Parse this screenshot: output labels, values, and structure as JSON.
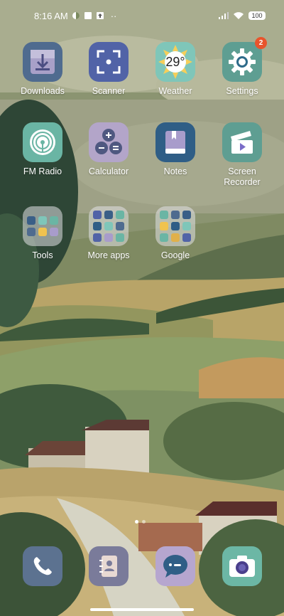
{
  "status": {
    "time": "8:16 AM",
    "battery": "100",
    "more": "··"
  },
  "apps": [
    {
      "id": "downloads",
      "label": "Downloads",
      "icon": "download-icon"
    },
    {
      "id": "scanner",
      "label": "Scanner",
      "icon": "scanner-icon"
    },
    {
      "id": "weather",
      "label": "Weather",
      "icon": "sun-icon",
      "temp": "29°"
    },
    {
      "id": "settings",
      "label": "Settings",
      "icon": "gear-icon",
      "badge": "2"
    },
    {
      "id": "fmradio",
      "label": "FM Radio",
      "icon": "radio-icon"
    },
    {
      "id": "calculator",
      "label": "Calculator",
      "icon": "calculator-icon"
    },
    {
      "id": "notes",
      "label": "Notes",
      "icon": "notes-icon"
    },
    {
      "id": "recorder",
      "label": "Screen\nRecorder",
      "icon": "clapper-icon"
    }
  ],
  "folders": [
    {
      "id": "tools",
      "label": "Tools"
    },
    {
      "id": "more-apps",
      "label": "More apps"
    },
    {
      "id": "google",
      "label": "Google"
    }
  ],
  "dock": [
    {
      "id": "phone",
      "icon": "phone-icon"
    },
    {
      "id": "contacts",
      "icon": "contacts-icon"
    },
    {
      "id": "messages",
      "icon": "message-icon"
    },
    {
      "id": "camera",
      "icon": "camera-icon"
    }
  ],
  "colors": {
    "downloads": "#4f6b8f",
    "scanner": "#5163a7",
    "weather": "#7fc6b9",
    "settings": "#5e9e92",
    "fmradio": "#6ab5a4",
    "calculator": "#b3a5c9",
    "notes": "#2f5e86",
    "recorder": "#5e9e92",
    "phone": "#5c7290",
    "contacts": "#7a7b9a",
    "messages": "#b6a6cf",
    "camera": "#6cb7a5",
    "badge": "#e8542c"
  }
}
